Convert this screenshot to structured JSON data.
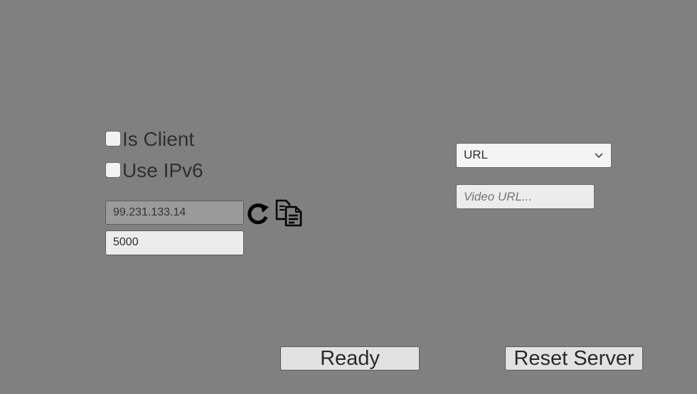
{
  "options": {
    "is_client": {
      "label": "Is Client",
      "checked": false
    },
    "use_ipv6": {
      "label": "Use IPv6",
      "checked": false
    }
  },
  "connection": {
    "ip_address": "99.231.133.14",
    "port": "5000",
    "refresh_icon": "refresh-icon",
    "copy_icon": "copy-icon"
  },
  "video": {
    "source_selected": "URL",
    "url_placeholder": "Video URL..."
  },
  "actions": {
    "ready_label": "Ready",
    "reset_server_label": "Reset Server"
  },
  "colors": {
    "background": "#808080",
    "field": "#ececec",
    "disabled_field": "#9a9a9a"
  }
}
